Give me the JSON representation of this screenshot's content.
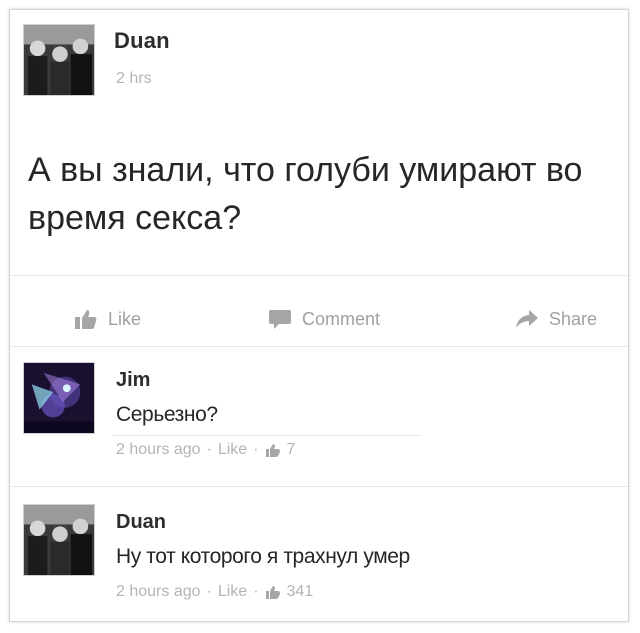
{
  "post": {
    "author": "Duan",
    "time": "2 hrs",
    "text": "А вы знали, что голуби умирают во время секса?"
  },
  "actions": {
    "like": "Like",
    "comment": "Comment",
    "share": "Share"
  },
  "comments": [
    {
      "author": "Jim",
      "text": "Серьезно?",
      "time": "2 hours ago",
      "sep1": "·",
      "like": "Like",
      "sep2": "·",
      "likes": "7"
    },
    {
      "author": "Duan",
      "text": "Ну тот которого я трахнул умер",
      "time": "2 hours ago",
      "sep1": "·",
      "like": "Like",
      "sep2": "·",
      "likes": "341"
    }
  ]
}
